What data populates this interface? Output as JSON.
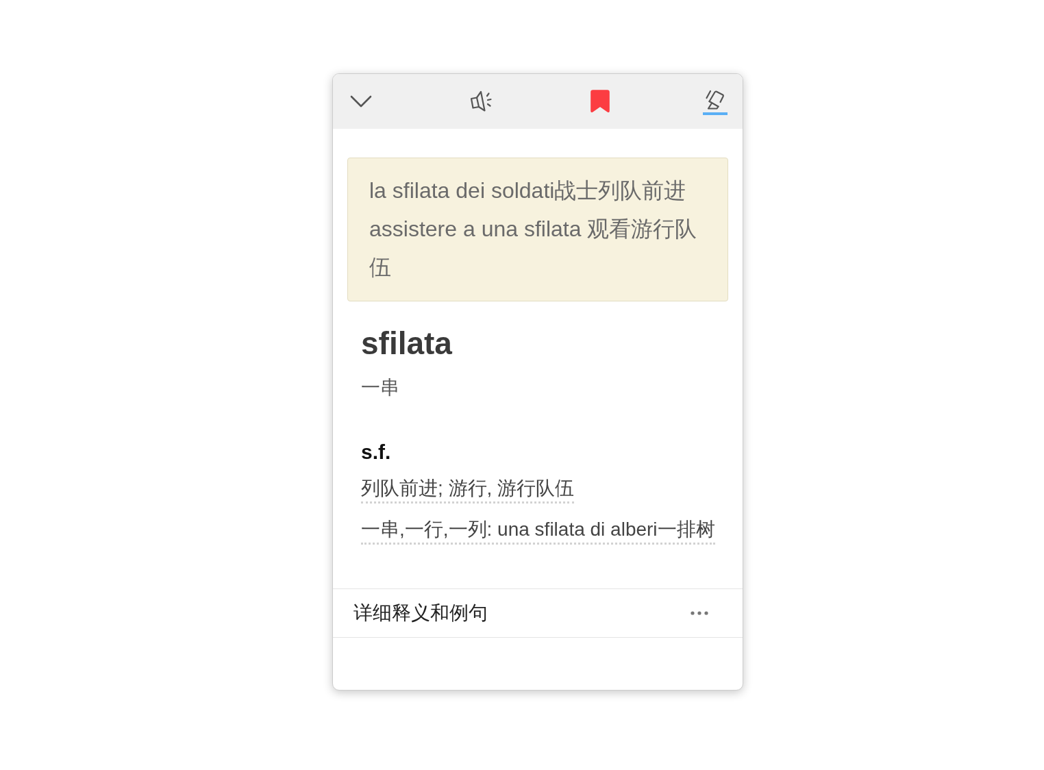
{
  "toolbar": {
    "bookmark": {
      "on": true
    },
    "highlighter": {
      "on": true
    }
  },
  "examples": [
    "la sfilata dei soldati战士列队前进",
    "assistere a una sfilata 观看游行队伍"
  ],
  "entry": {
    "headword": "sfilata",
    "gloss": "一串",
    "part_of_speech": "s.f.",
    "definitions": [
      "列队前进; 游行, 游行队伍",
      "一串,一行,一列: una sfilata di alberi一排树"
    ]
  },
  "footer": {
    "label": "详细释义和例句"
  }
}
